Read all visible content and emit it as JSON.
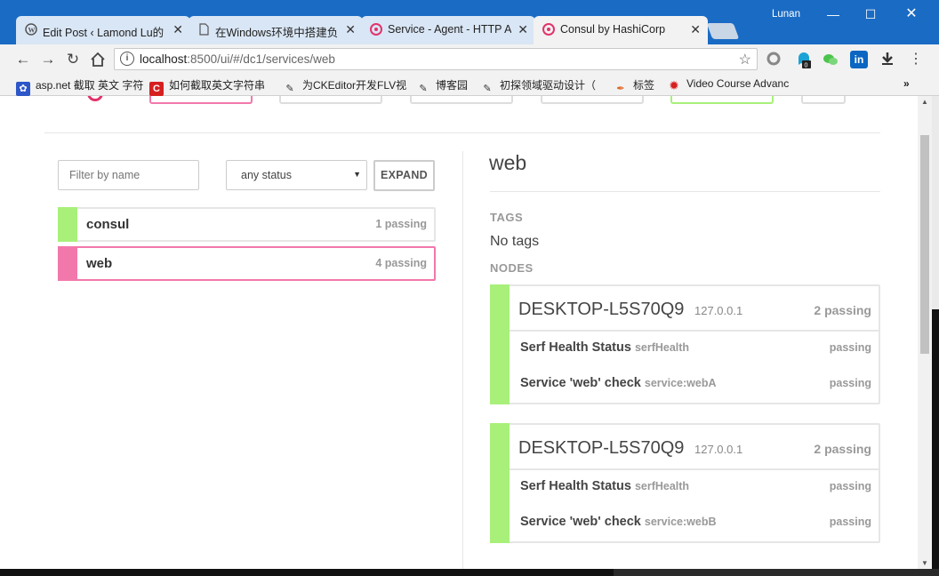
{
  "browser": {
    "tabs": [
      {
        "title": "Edit Post ‹ Lamond Lu的",
        "icon": "wordpress-icon"
      },
      {
        "title": "在Windows环境中搭建负",
        "icon": "document-icon"
      },
      {
        "title": "Service - Agent - HTTP A",
        "icon": "consul-icon"
      },
      {
        "title": "Consul by HashiCorp",
        "icon": "consul-icon"
      }
    ],
    "user": "Lunan",
    "url_host": "localhost",
    "url_path": ":8500/ui/#/dc1/services/web",
    "extension_badge": "0",
    "bookmarks": [
      {
        "label": "asp.net 截取 英文 字符",
        "icon": "paw-icon"
      },
      {
        "label": "如何截取英文字符串",
        "icon": "red-c-icon"
      },
      {
        "label": "为CKEditor开发FLV视",
        "icon": "quill-icon"
      },
      {
        "label": "博客园",
        "icon": "quill-icon"
      },
      {
        "label": "初探领域驱动设计（",
        "icon": "quill-icon"
      },
      {
        "label": "标签",
        "icon": "pen-icon"
      },
      {
        "label": "Video Course Advanc",
        "icon": "red-gear-icon"
      }
    ],
    "more_bookmarks": "»"
  },
  "colors": {
    "passing": "#a8f07a",
    "critical_selected": "#f278ab",
    "consul_pink": "#e2336b"
  },
  "left": {
    "filter_placeholder": "Filter by name",
    "status_value": "any status",
    "expand_label": "EXPAND",
    "services": [
      {
        "name": "consul",
        "count": "1 passing",
        "state": "passing"
      },
      {
        "name": "web",
        "count": "4 passing",
        "state": "selected"
      }
    ]
  },
  "detail": {
    "title": "web",
    "tags_label": "TAGS",
    "tags_value": "No tags",
    "nodes_label": "NODES",
    "nodes": [
      {
        "name": "DESKTOP-L5S70Q9",
        "address": "127.0.0.1",
        "count": "2 passing",
        "checks": [
          {
            "name": "Serf Health Status",
            "id": "serfHealth",
            "status": "passing"
          },
          {
            "name": "Service 'web' check",
            "id": "service:webA",
            "status": "passing"
          }
        ]
      },
      {
        "name": "DESKTOP-L5S70Q9",
        "address": "127.0.0.1",
        "count": "2 passing",
        "checks": [
          {
            "name": "Serf Health Status",
            "id": "serfHealth",
            "status": "passing"
          },
          {
            "name": "Service 'web' check",
            "id": "service:webB",
            "status": "passing"
          }
        ]
      }
    ]
  }
}
